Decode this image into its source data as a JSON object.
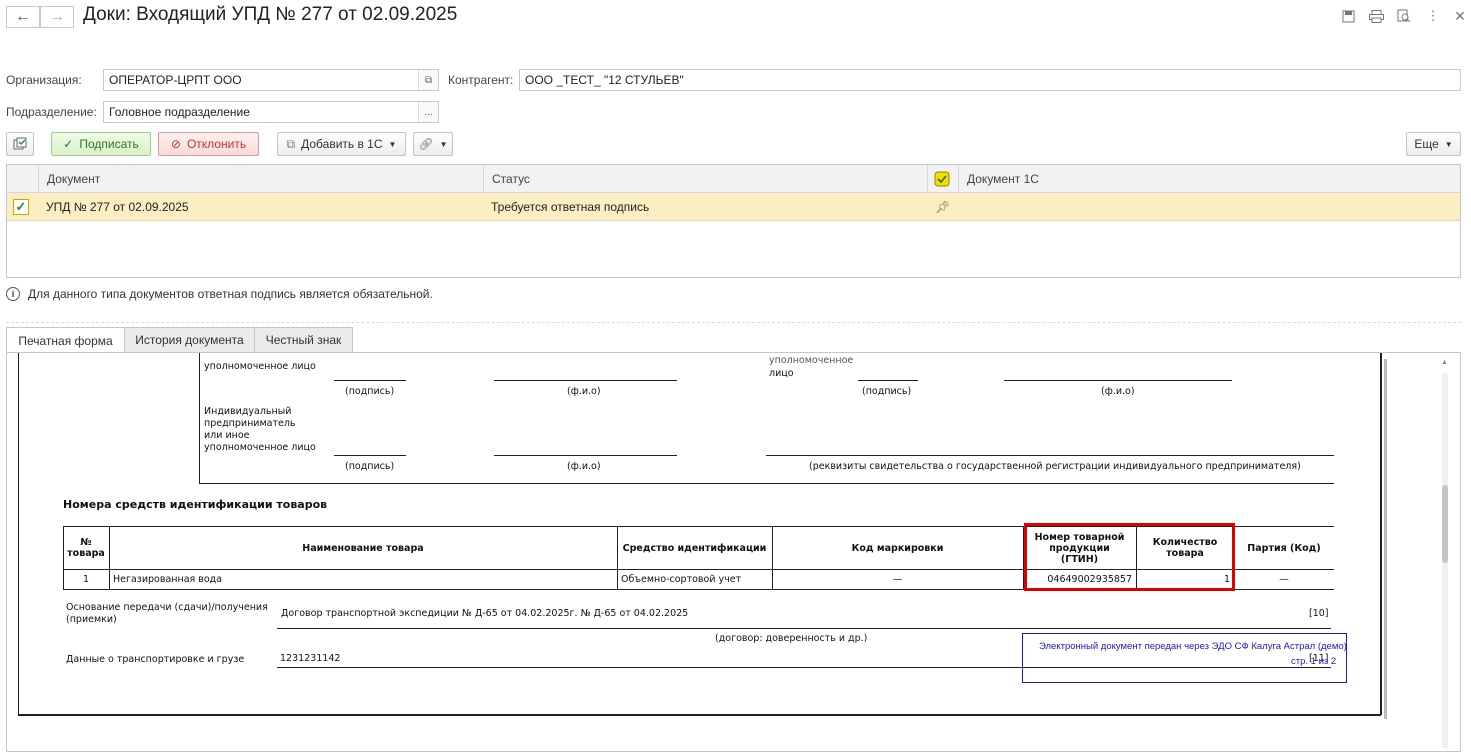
{
  "window": {
    "title": "Доки: Входящий УПД № 277 от 02.09.2025"
  },
  "header": {
    "org_label": "Организация:",
    "org_value": "ОПЕРАТОР-ЦРПТ ООО",
    "contractor_label": "Контрагент:",
    "contractor_value": "ООО _ТЕСТ_ \"12 СТУЛЬЕВ\"",
    "division_label": "Подразделение:",
    "division_value": "Головное подразделение",
    "division_btn": "..."
  },
  "toolbar": {
    "sign_label": "Подписать",
    "reject_label": "Отклонить",
    "add_label": "Добавить в 1С",
    "more_label": "Еще"
  },
  "grid": {
    "columns": [
      "Документ",
      "Статус",
      "Документ 1С"
    ],
    "rows": [
      {
        "document": "УПД № 277 от 02.09.2025",
        "status": "Требуется ответная подпись",
        "doc1c": "",
        "checked": true
      }
    ]
  },
  "info_text": "Для данного типа документов ответная подпись является обязательной.",
  "tabs": [
    "Печатная форма",
    "История документа",
    "Честный знак"
  ],
  "print_form": {
    "auth_person_top_left": "уполномоченное лицо",
    "auth_person_top_right_1": "уполномоченное",
    "auth_person_top_right_2": "лицо",
    "signature": "(подпись)",
    "fio": "(ф.и.о)",
    "ie_label_1": "Индивидуальный",
    "ie_label_2": "предприниматель",
    "ie_label_3": "или иное",
    "ie_label_4": "уполномоченное лицо",
    "ie_requisites": "(реквизиты свидетельства о государственной регистрации индивидуального предпринимателя)",
    "section_title": "Номера средств идентификации товаров",
    "table_headers": {
      "num": "№\nтовара",
      "name": "Наименование товара",
      "id_means": "Средство идентификации",
      "mark_code": "Код маркировки",
      "gtin": "Номер товарной\nпродукции\n(ГТИН)",
      "qty": "Количество\nтовара",
      "batch": "Партия (Код)"
    },
    "table_rows": [
      {
        "num": "1",
        "name": "Негазированная вода",
        "id_means": "Объемно-сортовой учет",
        "mark_code": "—",
        "gtin": "04649002935857",
        "qty": "1",
        "batch": "—"
      }
    ],
    "transfer_basis_label_1": "Основание передачи (сдачи)/получения",
    "transfer_basis_label_2": "(приемки)",
    "transfer_basis_value": "Договор транспортной экспедиции № Д-65 от 04.02.2025г. № Д-65 от 04.02.2025",
    "ref_10": "[10]",
    "contract_caption": "(договор: доверенность и др.)",
    "transport_label": "Данные о транспортировке и грузе",
    "transport_value": "1231231142",
    "ref_11": "[11]",
    "edo_stamp_line1": "Электронный документ передан через ЭДО СФ Калуга Астрал (демо)",
    "edo_stamp_line2": "стр. 1 из 2"
  },
  "colors": {
    "selected_row": "#fbeec3",
    "highlight_box": "#e00000",
    "stamp_blue": "#1a1ac8",
    "sign_green": "#2c7a1a",
    "reject_red": "#c0392b"
  }
}
